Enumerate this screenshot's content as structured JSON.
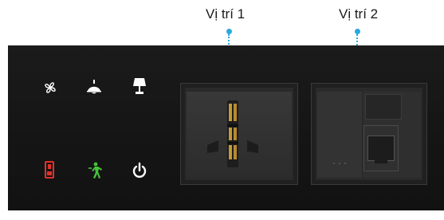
{
  "labels": {
    "position_1": "Vị trí 1",
    "position_2": "Vị trí 2"
  },
  "colors": {
    "pointer": "#2aa8e0",
    "panel": "#171717",
    "icon_white": "#ffffff",
    "icon_red": "#e0312b",
    "icon_green": "#47c13b"
  },
  "icons": {
    "row1": [
      "fan-icon",
      "ceiling-light-icon",
      "table-lamp-icon"
    ],
    "row2": [
      "key-card-icon",
      "exit-person-icon",
      "power-icon"
    ]
  },
  "sockets": [
    "universal-power-socket",
    "data-rj45-socket"
  ]
}
